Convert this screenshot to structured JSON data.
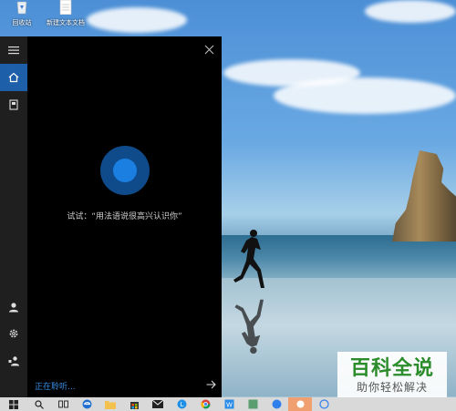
{
  "desktop": {
    "icons": [
      {
        "label": "回收站",
        "icon": "recycle-bin-icon"
      },
      {
        "label": "新建文本文档",
        "icon": "text-file-icon"
      }
    ]
  },
  "cortana": {
    "hint": "试试：“用法语说很高兴认识你”",
    "listening": "正在聆听...",
    "accent": "#1a7fe0"
  },
  "watermark": {
    "title": "百科全说",
    "subtitle": "助你轻松解决"
  },
  "taskbar": {
    "items": [
      "start-icon",
      "search-icon",
      "task-view-icon",
      "edge-icon",
      "file-explorer-icon",
      "store-icon",
      "mail-icon",
      "app-icon",
      "chrome-icon",
      "app2-icon",
      "app3-icon",
      "app4-icon",
      "app5-icon",
      "app6-icon"
    ]
  }
}
